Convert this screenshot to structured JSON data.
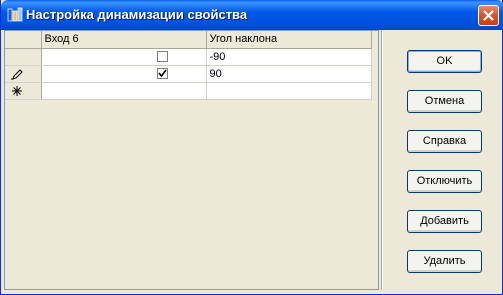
{
  "window": {
    "title": "Настройка динамизации свойства"
  },
  "grid": {
    "columns": [
      "Вход 6",
      "Угол наклона"
    ],
    "rows": [
      {
        "marker": "",
        "checked": false,
        "angle": "-90"
      },
      {
        "marker": "pencil-icon",
        "checked": true,
        "angle": "90"
      },
      {
        "marker": "new-row-icon",
        "checked": null,
        "angle": ""
      }
    ]
  },
  "buttons": {
    "ok": "OK",
    "cancel": "Отмена",
    "help": "Справка",
    "disable": "Отключить",
    "add": "Добавить",
    "delete": "Удалить"
  },
  "colors": {
    "titlebar": "#0054e3",
    "close": "#c63e16",
    "face": "#ece9d8"
  }
}
